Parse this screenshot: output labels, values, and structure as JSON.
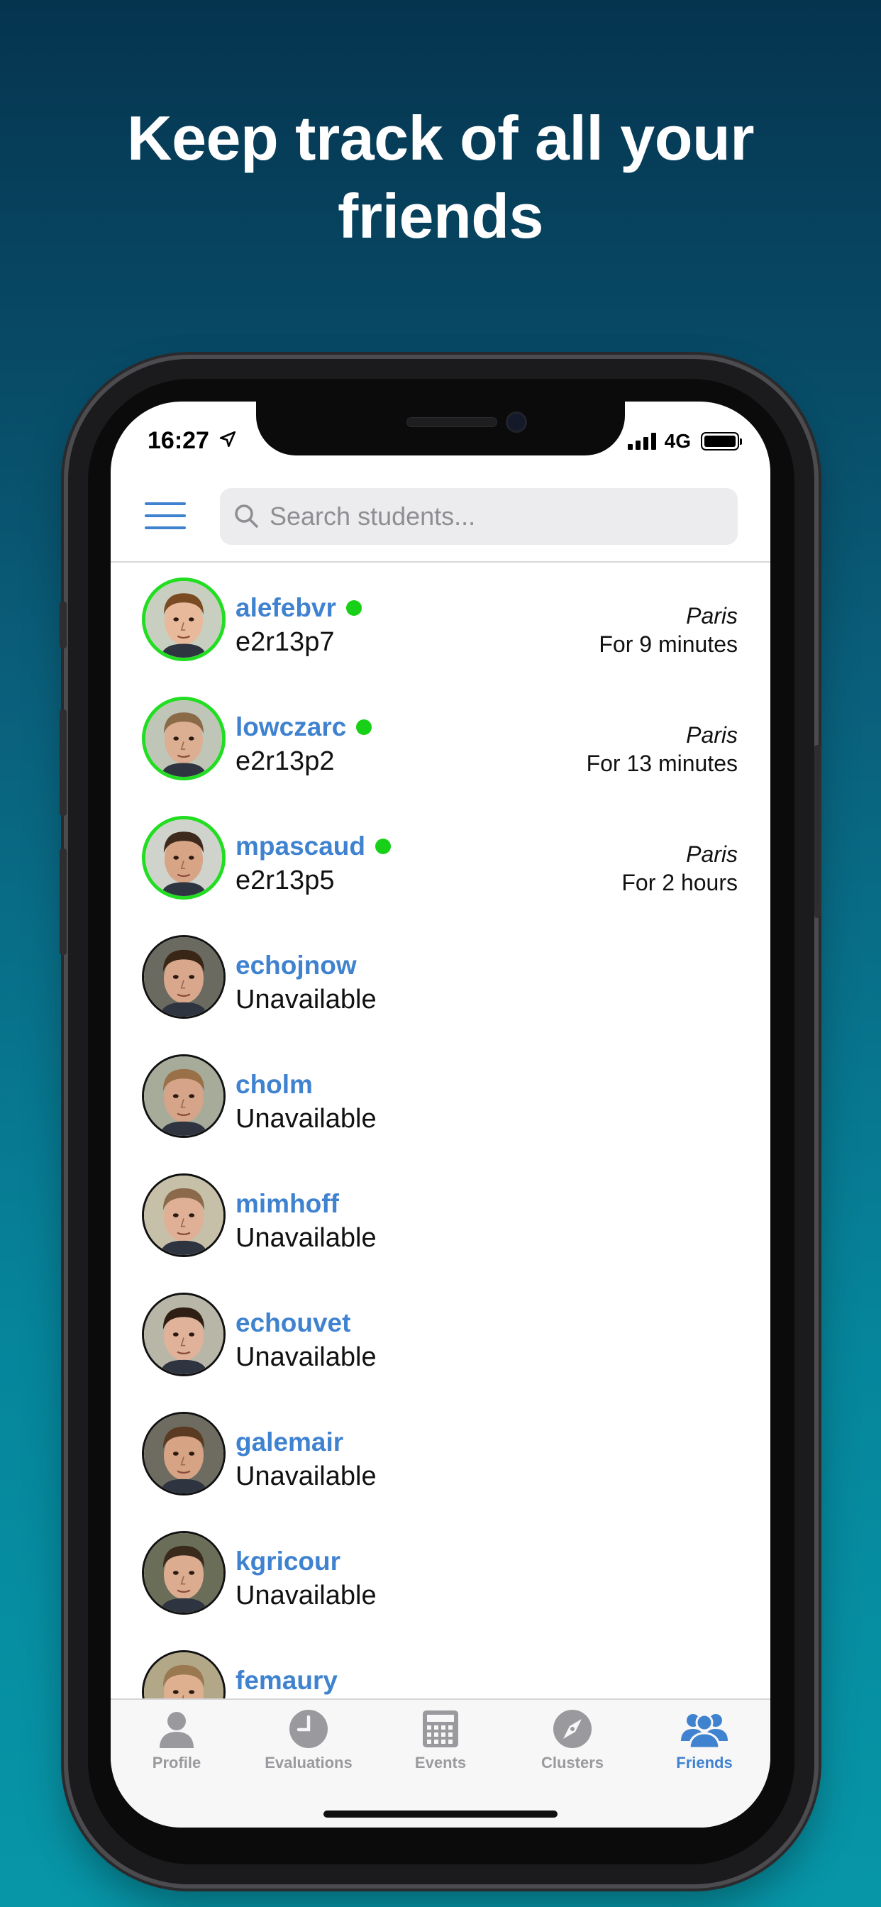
{
  "headline": {
    "line1": "Keep track of all your",
    "line2": "friends"
  },
  "status_bar": {
    "time": "16:27",
    "network": "4G"
  },
  "search": {
    "placeholder": "Search students..."
  },
  "friends": [
    {
      "login": "alefebvr",
      "detail": "e2r13p7",
      "online": true,
      "location": "Paris",
      "since": "For 9 minutes",
      "skin": "#e8b99a",
      "hair": "#7a4a22",
      "bg": "#c8cfc0"
    },
    {
      "login": "lowczarc",
      "detail": "e2r13p2",
      "online": true,
      "location": "Paris",
      "since": "For 13 minutes",
      "skin": "#dcae92",
      "hair": "#8b6a48",
      "bg": "#bfc6b8"
    },
    {
      "login": "mpascaud",
      "detail": "e2r13p5",
      "online": true,
      "location": "Paris",
      "since": "For 2 hours",
      "skin": "#d7a486",
      "hair": "#3d2a1c",
      "bg": "#cfd3cc"
    },
    {
      "login": "echojnow",
      "detail": "Unavailable",
      "online": false,
      "location": "",
      "since": "",
      "skin": "#d9a88c",
      "hair": "#3a2616",
      "bg": "#6b6a60"
    },
    {
      "login": "cholm",
      "detail": "Unavailable",
      "online": false,
      "location": "",
      "since": "",
      "skin": "#d6a488",
      "hair": "#9a7048",
      "bg": "#a7ab9a"
    },
    {
      "login": "mimhoff",
      "detail": "Unavailable",
      "online": false,
      "location": "",
      "since": "",
      "skin": "#dfb095",
      "hair": "#8a6a4a",
      "bg": "#c7c0a8"
    },
    {
      "login": "echouvet",
      "detail": "Unavailable",
      "online": false,
      "location": "",
      "since": "",
      "skin": "#e0b29a",
      "hair": "#2e1e14",
      "bg": "#b8b6a6"
    },
    {
      "login": "galemair",
      "detail": "Unavailable",
      "online": false,
      "location": "",
      "since": "",
      "skin": "#d6a385",
      "hair": "#5a3a22",
      "bg": "#6e6c60"
    },
    {
      "login": "kgricour",
      "detail": "Unavailable",
      "online": false,
      "location": "",
      "since": "",
      "skin": "#dcac90",
      "hair": "#3a2a1c",
      "bg": "#6a6e58"
    },
    {
      "login": "femaury",
      "detail": "",
      "online": false,
      "location": "",
      "since": "",
      "skin": "#deb090",
      "hair": "#9a7850",
      "bg": "#b2a888"
    }
  ],
  "tabs": [
    {
      "label": "Profile",
      "icon": "person-icon",
      "active": false
    },
    {
      "label": "Evaluations",
      "icon": "clock-icon",
      "active": false
    },
    {
      "label": "Events",
      "icon": "calendar-icon",
      "active": false
    },
    {
      "label": "Clusters",
      "icon": "compass-icon",
      "active": false
    },
    {
      "label": "Friends",
      "icon": "friends-icon",
      "active": true
    }
  ],
  "colors": {
    "accent": "#3f82cf",
    "online": "#18d018",
    "tab_inactive": "#9a9a9e"
  }
}
